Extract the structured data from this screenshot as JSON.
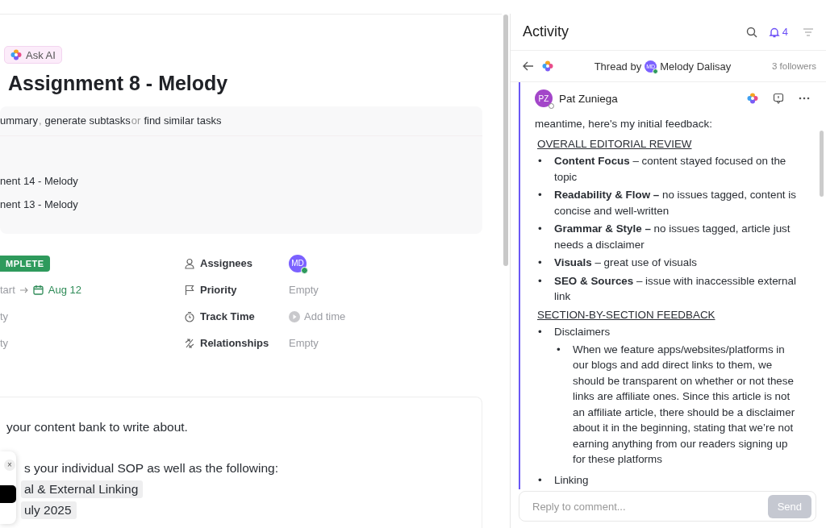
{
  "ask_ai": {
    "label": "Ask AI"
  },
  "task": {
    "title": "Assignment 8 - Melody"
  },
  "ai_box": {
    "prompt": [
      {
        "kind": "action",
        "text": "ummary"
      },
      {
        "kind": "connector",
        "text": ","
      },
      {
        "kind": "action",
        "text": "generate subtasks"
      },
      {
        "kind": "connector",
        "text": "or"
      },
      {
        "kind": "action",
        "text": "find similar tasks"
      }
    ],
    "subtasks": [
      "nent 14 - Melody",
      "nent 13 - Melody"
    ]
  },
  "left_fields": [
    {
      "kind": "status",
      "text": "MPLETE"
    },
    {
      "kind": "dates",
      "start": "tart",
      "due": "Aug 12"
    },
    {
      "kind": "plain",
      "text": "ty"
    },
    {
      "kind": "plain",
      "text": "ty"
    }
  ],
  "fields": [
    {
      "kind": "people",
      "label": "Assignees",
      "initials": "MD",
      "online": true
    },
    {
      "kind": "priority",
      "label": "Priority",
      "value": "Empty"
    },
    {
      "kind": "time",
      "label": "Track Time",
      "value": "Add time"
    },
    {
      "kind": "relation",
      "label": "Relationships",
      "value": "Empty"
    }
  ],
  "description": [
    {
      "text": "your content bank to write about.",
      "highlighted": false
    },
    {
      "text": "s your individual SOP as well as the following:",
      "highlighted": false
    },
    {
      "text": "al & External Linking",
      "highlighted": true
    },
    {
      "text": "uly 2025",
      "highlighted": true
    }
  ],
  "popup": {
    "close": "×"
  },
  "activity": {
    "title": "Activity",
    "notifications": "4",
    "thread": {
      "prefix": "Thread by",
      "initials": "MD",
      "online": true,
      "author": "Melody Dalisay",
      "followers": "3 followers"
    },
    "comment": {
      "initials": "PZ",
      "online": false,
      "author": "Pat Zuniega",
      "body": [
        {
          "kind": "para",
          "text": "meantime, here's my initial feedback:"
        },
        {
          "kind": "heading",
          "text": "OVERALL EDITORIAL REVIEW"
        },
        {
          "kind": "bullets",
          "marker": "•",
          "items": [
            {
              "text": "**Content Focus** – content stayed focused on the topic"
            },
            {
              "text": "**Readability & Flow –** no issues tagged, content is concise and well-written"
            },
            {
              "text": "**Grammar & Style –** no issues tagged, article just needs a disclaimer"
            },
            {
              "text": "**Visuals** – great use of visuals"
            },
            {
              "text": "**SEO & Sources** – issue with inaccessible external link"
            }
          ]
        },
        {
          "kind": "heading",
          "text": "SECTION-BY-SECTION FEEDBACK"
        },
        {
          "kind": "bullets",
          "marker": "•",
          "items": [
            {
              "text": "Disclaimers",
              "children": [
                {
                  "text": "When we feature apps/websites/platforms in our blogs and add direct links to them, we should be transparent on whether or not these links are affiliate ones. Since this article is not an affiliate article, there should be a disclaimer about it in the beginning, stating that we’re not earning anything from our readers signing up for these platforms"
                }
              ]
            },
            {
              "text": "Linking"
            }
          ]
        }
      ]
    },
    "reply": {
      "placeholder": "Reply to comment...",
      "send": "Send",
      "disabled": true
    }
  }
}
